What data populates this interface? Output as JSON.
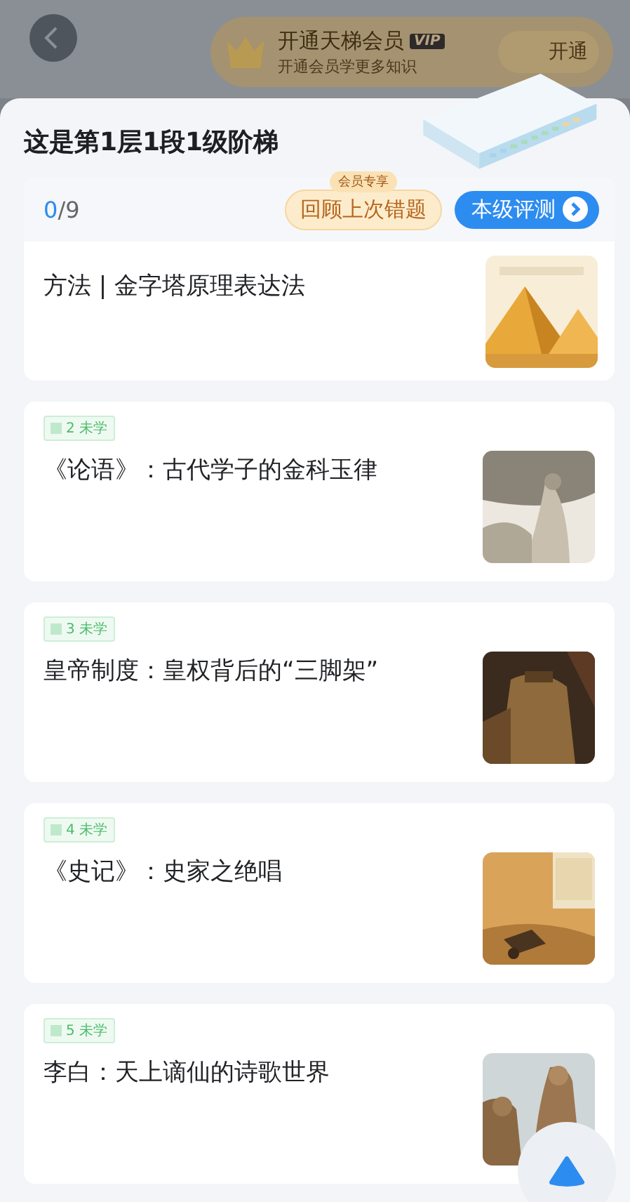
{
  "header": {
    "member_banner": {
      "title": "开通天梯会员",
      "badge": "VIP",
      "subtitle": "开通会员学更多知识",
      "button": "开通"
    }
  },
  "sheet": {
    "title": "这是第1层1段1级阶梯",
    "progress": {
      "done": "0",
      "rest": "/9"
    },
    "review_button": {
      "label": "回顾上次错题",
      "badge": "会员专享"
    },
    "test_button": {
      "label": "本级评测"
    },
    "lessons": [
      {
        "title": "方法 | 金字塔原理表达法"
      },
      {
        "number": "2",
        "status": "未学",
        "title": "《论语》：古代学子的金科玉律"
      },
      {
        "number": "3",
        "status": "未学",
        "title": "皇帝制度：皇权背后的“三脚架”"
      },
      {
        "number": "4",
        "status": "未学",
        "title": "《史记》：史家之绝唱"
      },
      {
        "number": "5",
        "status": "未学",
        "title": "李白：天上谪仙的诗歌世界"
      }
    ]
  }
}
